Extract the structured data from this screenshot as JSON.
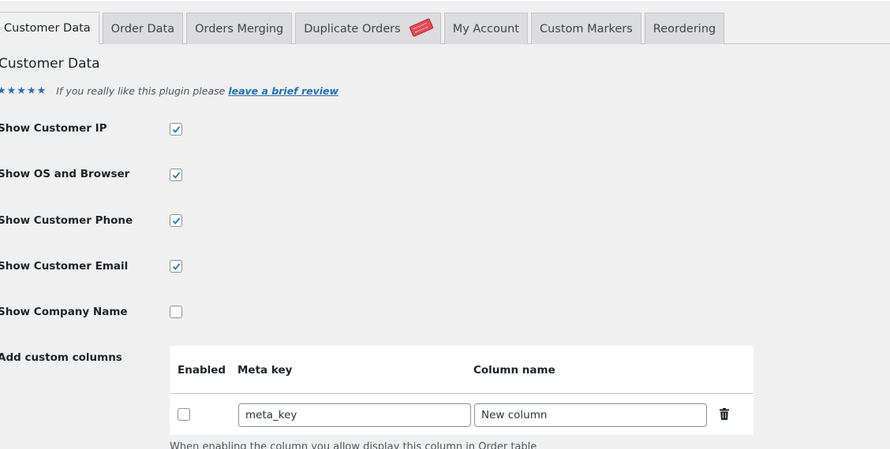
{
  "tabs": [
    {
      "label": "Customer Data",
      "active": true
    },
    {
      "label": "Order Data",
      "active": false
    },
    {
      "label": "Orders Merging",
      "active": false
    },
    {
      "label": "Duplicate Orders",
      "active": false,
      "badge": "new-badge"
    },
    {
      "label": "My Account",
      "active": false
    },
    {
      "label": "Custom Markers",
      "active": false
    },
    {
      "label": "Reordering",
      "active": false
    }
  ],
  "page": {
    "title": "Customer Data",
    "review": {
      "stars": "★★★★★",
      "text": "If you really like this plugin please",
      "link_text": "leave a brief review"
    }
  },
  "settings": [
    {
      "label": "Show Customer IP",
      "checked": true
    },
    {
      "label": "Show OS and Browser",
      "checked": true
    },
    {
      "label": "Show Customer Phone",
      "checked": true
    },
    {
      "label": "Show Customer Email",
      "checked": true
    },
    {
      "label": "Show Company Name",
      "checked": false
    }
  ],
  "custom_columns": {
    "label": "Add custom columns",
    "headers": {
      "enabled": "Enabled",
      "meta_key": "Meta key",
      "column_name": "Column name"
    },
    "row": {
      "enabled": false,
      "meta_key": "meta_key",
      "column_name": "New column"
    },
    "note": "When enabling the column you allow display this column in Order table"
  },
  "colors": {
    "accent": "#2271b1",
    "background": "#f0f0f1"
  }
}
